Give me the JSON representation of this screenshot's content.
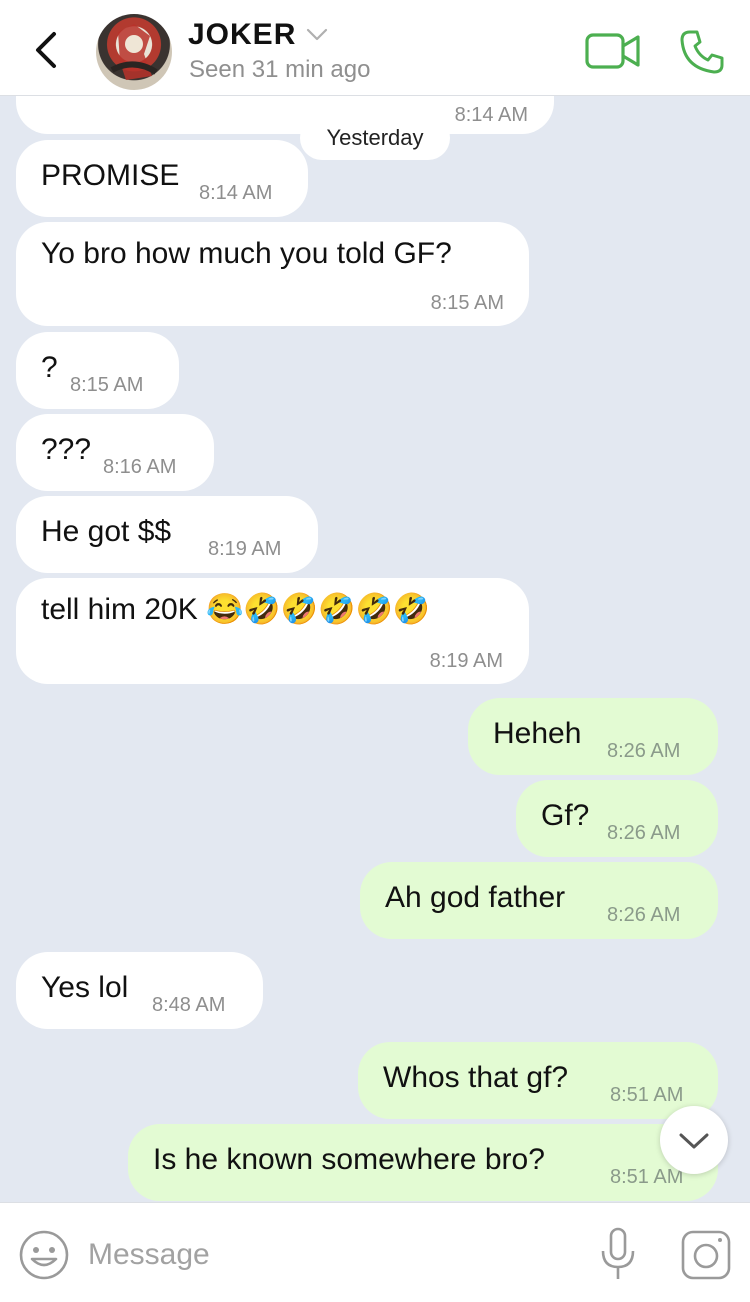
{
  "header": {
    "contact_name": "JOKER",
    "status": "Seen 31 min ago"
  },
  "chat": {
    "day_separator": "Yesterday",
    "partial_top_time": "8:14 AM",
    "messages": [
      {
        "dir": "in",
        "text": "PROMISE",
        "time": "8:14 AM"
      },
      {
        "dir": "in",
        "text": "Yo bro how much you told GF?",
        "time": "8:15 AM"
      },
      {
        "dir": "in",
        "text": "?",
        "time": "8:15 AM"
      },
      {
        "dir": "in",
        "text": "???",
        "time": "8:16 AM"
      },
      {
        "dir": "in",
        "text": "He got $$",
        "time": "8:19 AM"
      },
      {
        "dir": "in",
        "text": "tell him 20K 😂🤣🤣🤣🤣🤣",
        "time": "8:19 AM"
      },
      {
        "dir": "out",
        "text": "Heheh",
        "time": "8:26 AM"
      },
      {
        "dir": "out",
        "text": "Gf?",
        "time": "8:26 AM"
      },
      {
        "dir": "out",
        "text": "Ah god father",
        "time": "8:26 AM"
      },
      {
        "dir": "in",
        "text": "Yes lol",
        "time": "8:48 AM"
      },
      {
        "dir": "out",
        "text": "Whos that gf?",
        "time": "8:51 AM"
      },
      {
        "dir": "out",
        "text": "Is he known somewhere bro?",
        "time": "8:51 AM"
      }
    ]
  },
  "composer": {
    "placeholder": "Message"
  },
  "icons": {
    "back": "chevron-left-icon",
    "video": "video-camera-icon",
    "call": "phone-icon",
    "emoji": "smiley-icon",
    "mic": "microphone-icon",
    "camera": "camera-icon",
    "scroll": "chevron-down-icon"
  },
  "colors": {
    "accent": "#4caf50",
    "incoming_bubble": "#ffffff",
    "outgoing_bubble": "#e3fbd3",
    "chat_background": "#e3e8f1"
  }
}
